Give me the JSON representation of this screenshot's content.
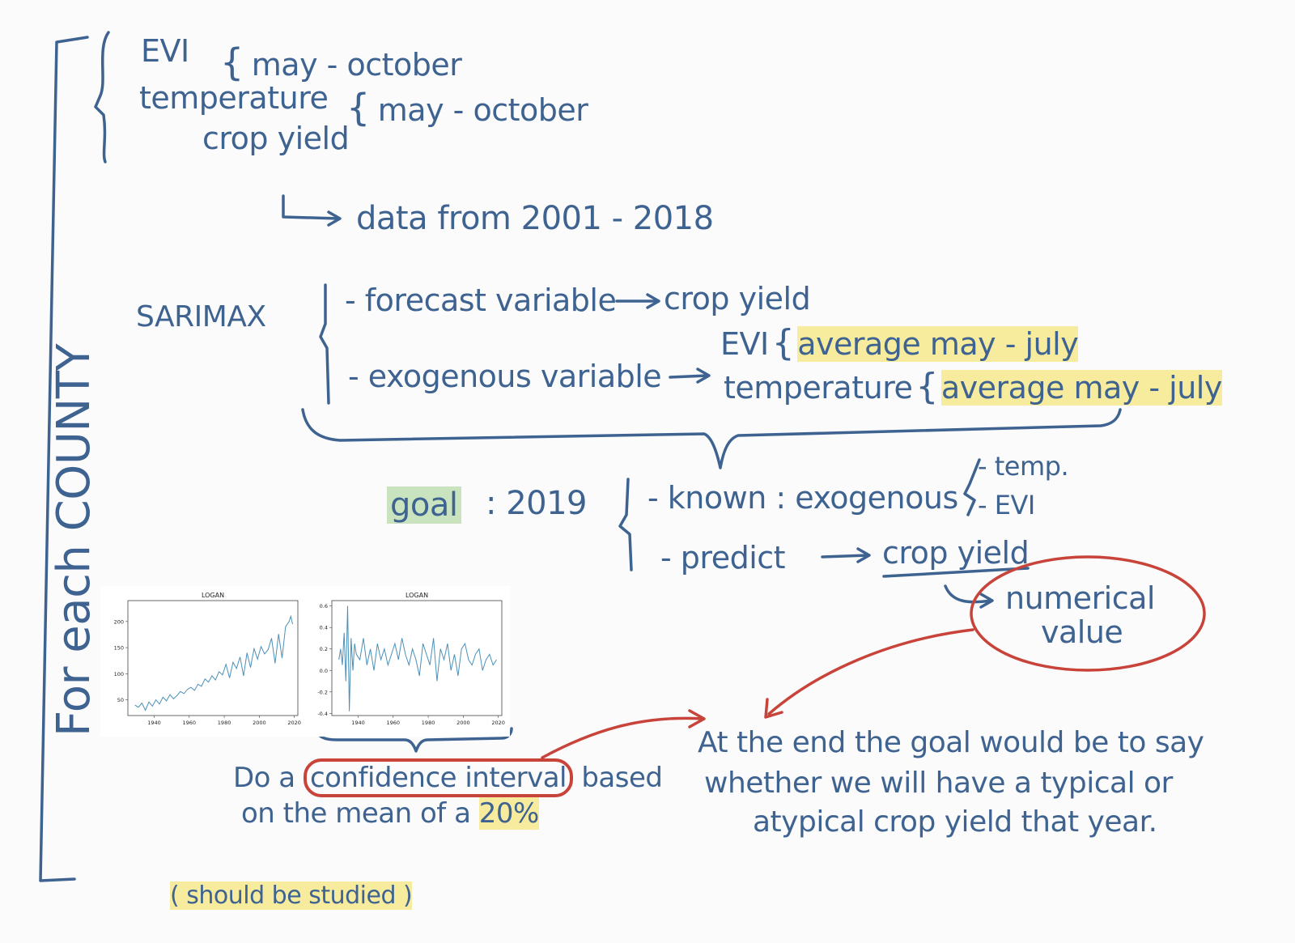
{
  "side_label": "For each COUNTY",
  "inputs": {
    "evi": "EVI",
    "evi_range": "may - october",
    "temperature": "temperature",
    "temperature_range": "may - october",
    "crop_yield": "crop yield",
    "data_note": "data from 2001 - 2018"
  },
  "sarimax": {
    "label": "SARIMAX",
    "forecast": "- forecast variable",
    "forecast_target": "crop yield",
    "exogenous": "- exogenous variable",
    "exo_evi": "EVI",
    "exo_evi_avg": "average may - july",
    "exo_temperature": "temperature",
    "exo_temperature_avg": "average may - july"
  },
  "goal": {
    "label": "goal",
    "year": ": 2019",
    "known": "- known : exogenous",
    "known_temp": "- temp.",
    "known_evi": "- EVI",
    "predict": "- predict",
    "predict_target": "crop yield",
    "numerical_value_line1": "numerical",
    "numerical_value_line2": "value"
  },
  "charts": [
    {
      "type": "line",
      "title": "LOGAN",
      "yticks": [
        "200",
        "150",
        "100",
        "50"
      ],
      "xticks": [
        "1940",
        "1960",
        "1980",
        "2000",
        "2020"
      ],
      "ylim": [
        20,
        240
      ],
      "xlim": [
        1925,
        2022
      ],
      "series_color": "#4a90b8",
      "x": [
        1929,
        1931,
        1933,
        1935,
        1937,
        1939,
        1941,
        1943,
        1945,
        1947,
        1949,
        1951,
        1953,
        1955,
        1957,
        1959,
        1961,
        1963,
        1965,
        1967,
        1969,
        1971,
        1973,
        1975,
        1977,
        1979,
        1981,
        1983,
        1985,
        1987,
        1989,
        1991,
        1993,
        1995,
        1997,
        1999,
        2001,
        2003,
        2005,
        2007,
        2009,
        2011,
        2013,
        2015,
        2017,
        2018,
        2019
      ],
      "y": [
        40,
        36,
        44,
        30,
        46,
        38,
        50,
        42,
        55,
        48,
        60,
        52,
        58,
        66,
        62,
        70,
        74,
        68,
        80,
        76,
        90,
        84,
        96,
        88,
        104,
        98,
        118,
        92,
        122,
        110,
        132,
        96,
        140,
        112,
        148,
        128,
        152,
        138,
        146,
        168,
        120,
        176,
        130,
        190,
        200,
        210,
        195
      ]
    },
    {
      "type": "line",
      "title": "LOGAN",
      "yticks": [
        "0.6",
        "0.4",
        "0.2",
        "0.0",
        "-0.2",
        "-0.4"
      ],
      "xticks": [
        "1940",
        "1960",
        "1980",
        "2000",
        "2020"
      ],
      "ylim": [
        -0.42,
        0.65
      ],
      "xlim": [
        1925,
        2022
      ],
      "series_color": "#4a90b8",
      "x": [
        1929,
        1930,
        1931,
        1932,
        1933,
        1934,
        1935,
        1936,
        1937,
        1938,
        1939,
        1941,
        1943,
        1945,
        1947,
        1949,
        1951,
        1953,
        1955,
        1957,
        1959,
        1961,
        1963,
        1965,
        1967,
        1969,
        1971,
        1973,
        1975,
        1977,
        1979,
        1981,
        1983,
        1985,
        1987,
        1989,
        1991,
        1993,
        1995,
        1997,
        1999,
        2001,
        2003,
        2005,
        2007,
        2009,
        2011,
        2013,
        2015,
        2017,
        2019
      ],
      "y": [
        0.1,
        0.2,
        0.05,
        0.35,
        -0.1,
        0.6,
        -0.38,
        0.3,
        0.0,
        0.25,
        0.15,
        0.1,
        0.3,
        0.05,
        0.2,
        0.0,
        0.25,
        0.1,
        0.2,
        0.05,
        0.15,
        0.25,
        0.1,
        0.3,
        0.15,
        0.05,
        0.2,
        0.1,
        -0.05,
        0.25,
        0.15,
        0.05,
        0.3,
        -0.1,
        0.2,
        0.1,
        0.25,
        0.0,
        0.15,
        -0.05,
        0.2,
        0.25,
        0.1,
        0.05,
        0.15,
        0.2,
        0.0,
        0.1,
        0.15,
        0.05,
        0.1
      ]
    }
  ],
  "confidence": {
    "line1_pre": "Do a",
    "line1_boxed": "confidence interval",
    "line1_post": "based",
    "line2_pre": "on the mean of a",
    "line2_hl": "20%"
  },
  "conclusion": {
    "line1": "At the end the goal would be to say",
    "line2": "whether we will have a typical or",
    "line3": "atypical crop yield that year."
  },
  "footnote": "( should be studied )",
  "colors": {
    "ink_blue": "#3e6391",
    "ink_red": "#c8443a",
    "highlight_yellow": "#f6e88c",
    "highlight_green": "#c6e2ba"
  }
}
